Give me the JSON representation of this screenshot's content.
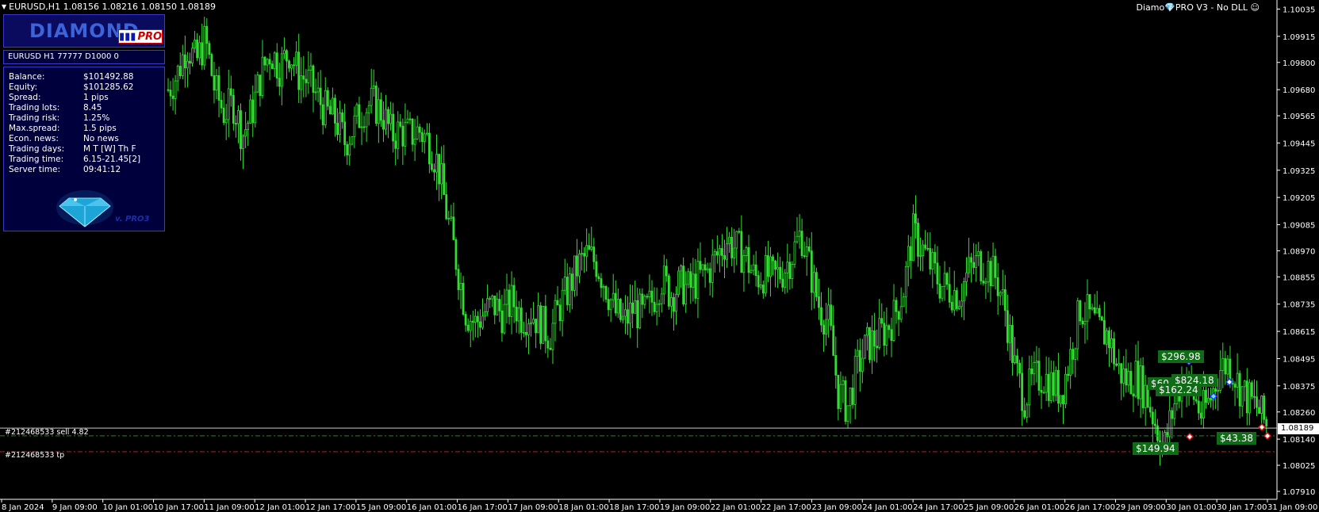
{
  "window": {
    "title": "EURUSD,H1  1.08156 1.08216 1.08150 1.08189",
    "ea_label_pre": "Diamo",
    "ea_label_post": "PRO V3 - No DLL",
    "ea_label_smiley": "☺"
  },
  "panel": {
    "logo_text": "DIAMOND",
    "pro_badge": "PRO",
    "symbol_line": "EURUSD H1 77777  D1000 0",
    "version": "v. PRO3",
    "rows": [
      {
        "label": "Balance:",
        "value": "$101492.88"
      },
      {
        "label": "Equity:",
        "value": "$101285.62"
      },
      {
        "label": "Spread:",
        "value": "1 pips"
      },
      {
        "label": "Trading lots:",
        "value": "8.45"
      },
      {
        "label": "Trading risk:",
        "value": "1.25%"
      },
      {
        "label": "Max.spread:",
        "value": "1.5 pips"
      },
      {
        "label": "Econ. news:",
        "value": "No news"
      },
      {
        "label": "Trading days:",
        "value": "M T [W] Th F"
      },
      {
        "label": "Trading time:",
        "value": "6.15-21.45[2]"
      },
      {
        "label": "Server time:",
        "value": "09:41:12"
      }
    ]
  },
  "orders": {
    "sell_label": "#212468533 sell 4.82",
    "tp_label": "#212468533 tp"
  },
  "profit_tags": [
    "$296.98",
    "$824.18",
    "$162.24",
    "$43.38",
    "$149.94",
    "$60"
  ],
  "current_price": "1.08189",
  "colors": {
    "background": "#000000",
    "candle": "#33dd33",
    "sell_line": "#1a8f1a",
    "tp_line": "#dd1111",
    "profit_tag": "#0f6b16",
    "panel_bg": "#00003c",
    "panel_border": "#3a3ad0"
  },
  "chart_data": {
    "type": "candlestick",
    "symbol": "EURUSD",
    "timeframe": "H1",
    "ohlc_last": {
      "open": 1.08156,
      "high": 1.08216,
      "low": 1.0815,
      "close": 1.08189
    },
    "y_ticks": [
      "1.10035",
      "1.09915",
      "1.09800",
      "1.09680",
      "1.09565",
      "1.09445",
      "1.09325",
      "1.09205",
      "1.09085",
      "1.08970",
      "1.08855",
      "1.08735",
      "1.08615",
      "1.08495",
      "1.08375",
      "1.08260",
      "1.08140",
      "1.08025",
      "1.07910"
    ],
    "ylim": [
      1.07875,
      1.10075
    ],
    "x_ticks": [
      "8 Jan 2024",
      "9 Jan 09:00",
      "10 Jan 01:00",
      "10 Jan 17:00",
      "11 Jan 09:00",
      "12 Jan 01:00",
      "12 Jan 17:00",
      "15 Jan 09:00",
      "16 Jan 01:00",
      "16 Jan 17:00",
      "17 Jan 09:00",
      "18 Jan 01:00",
      "18 Jan 17:00",
      "19 Jan 09:00",
      "22 Jan 01:00",
      "22 Jan 17:00",
      "23 Jan 09:00",
      "24 Jan 01:00",
      "24 Jan 17:00",
      "25 Jan 09:00",
      "26 Jan 01:00",
      "26 Jan 17:00",
      "29 Jan 09:00",
      "30 Jan 01:00",
      "30 Jan 17:00",
      "31 Jan 09:00"
    ],
    "close_path": [
      1.0968,
      1.0975,
      1.0988,
      1.098,
      1.099,
      1.0968,
      1.0958,
      1.0962,
      1.0948,
      1.0958,
      1.0975,
      1.0985,
      1.0978,
      1.0985,
      1.0975,
      1.0972,
      1.0965,
      1.0958,
      1.0955,
      1.0945,
      1.0952,
      1.096,
      1.0962,
      1.0958,
      1.0948,
      1.095,
      1.0948,
      1.095,
      1.0945,
      1.0935,
      1.0912,
      1.0892,
      1.087,
      1.0865,
      1.087,
      1.0873,
      1.0869,
      1.0875,
      1.0868,
      1.087,
      1.0865,
      1.086,
      1.0872,
      1.088,
      1.089,
      1.0895,
      1.0892,
      1.0882,
      1.087,
      1.0865,
      1.0872,
      1.0868,
      1.0875,
      1.0885,
      1.0878,
      1.0882,
      1.088,
      1.0885,
      1.0888,
      1.0895,
      1.0902,
      1.0898,
      1.0895,
      1.0885,
      1.0887,
      1.0885,
      1.0888,
      1.0895,
      1.0905,
      1.0888,
      1.0872,
      1.0865,
      1.0835,
      1.0828,
      1.0845,
      1.0855,
      1.0858,
      1.0862,
      1.0868,
      1.088,
      1.0905,
      1.0898,
      1.089,
      1.0882,
      1.088,
      1.0878,
      1.0888,
      1.0892,
      1.089,
      1.0885,
      1.087,
      1.0845,
      1.0832,
      1.084,
      1.0842,
      1.0838,
      1.0835,
      1.0852,
      1.0872,
      1.0868,
      1.0862,
      1.086,
      1.0845,
      1.084,
      1.0842,
      1.0835,
      1.0822,
      1.081,
      1.0828,
      1.0842,
      1.0835,
      1.0825,
      1.0832,
      1.0845,
      1.0848,
      1.0838,
      1.0832,
      1.0828,
      1.082
    ],
    "orders": [
      {
        "id": "212468533",
        "side": "sell",
        "lots": 4.82,
        "price": 1.08155
      },
      {
        "id": "212468533",
        "kind": "tp",
        "price": 1.08085
      }
    ],
    "profit_labels": [
      "$296.98",
      "$824.18",
      "$162.24",
      "$43.38",
      "$149.94",
      "$60"
    ]
  }
}
